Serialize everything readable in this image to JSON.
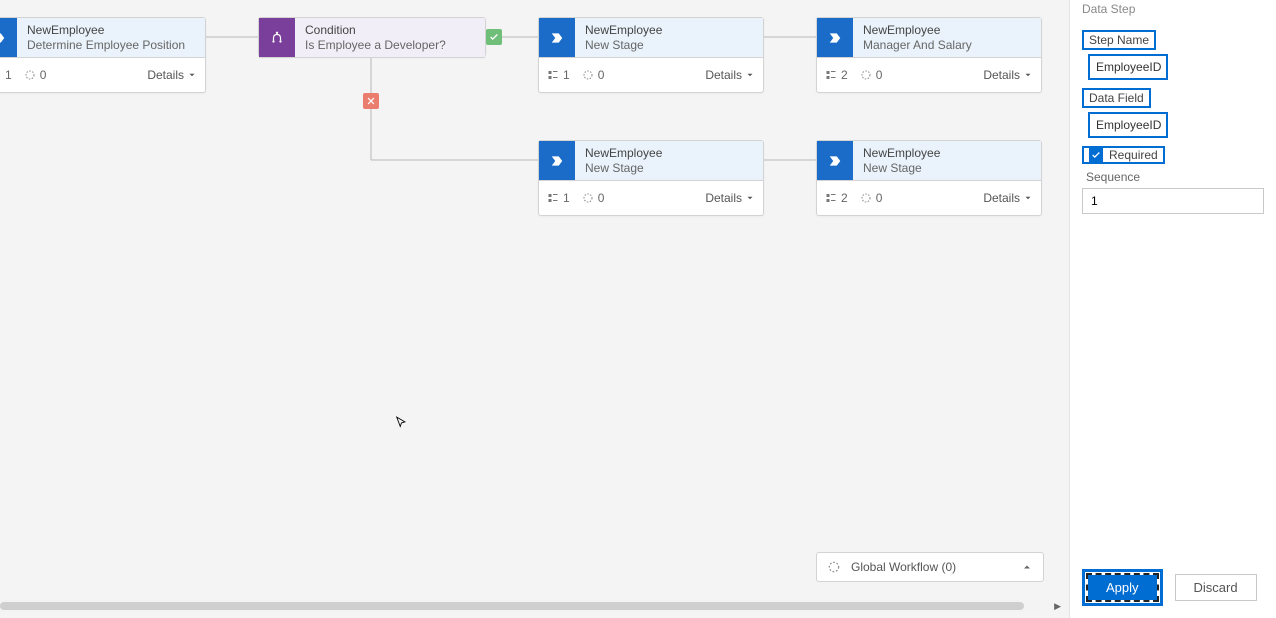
{
  "sidepanel": {
    "section_title": "Data Step",
    "step_name_label": "Step Name",
    "step_name_value": "EmployeeID",
    "data_field_label": "Data Field",
    "data_field_value": "EmployeeID",
    "required_label": "Required",
    "required_checked": true,
    "sequence_label": "Sequence",
    "sequence_value": "1",
    "apply_label": "Apply",
    "discard_label": "Discard"
  },
  "global_workflow_label": "Global Workflow (0)",
  "details_label": "Details",
  "nodes": {
    "n1": {
      "entity": "NewEmployee",
      "sub": "Determine Employee Position",
      "steps": "1",
      "count": "0"
    },
    "cond": {
      "entity": "Condition",
      "sub": "Is Employee a Developer?"
    },
    "n2": {
      "entity": "NewEmployee",
      "sub": "New Stage",
      "steps": "1",
      "count": "0"
    },
    "n3": {
      "entity": "NewEmployee",
      "sub": "Manager And Salary",
      "steps": "2",
      "count": "0"
    },
    "n4": {
      "entity": "NewEmployee",
      "sub": "New Stage",
      "steps": "1",
      "count": "0"
    },
    "n5": {
      "entity": "NewEmployee",
      "sub": "New Stage",
      "steps": "2",
      "count": "0"
    }
  }
}
